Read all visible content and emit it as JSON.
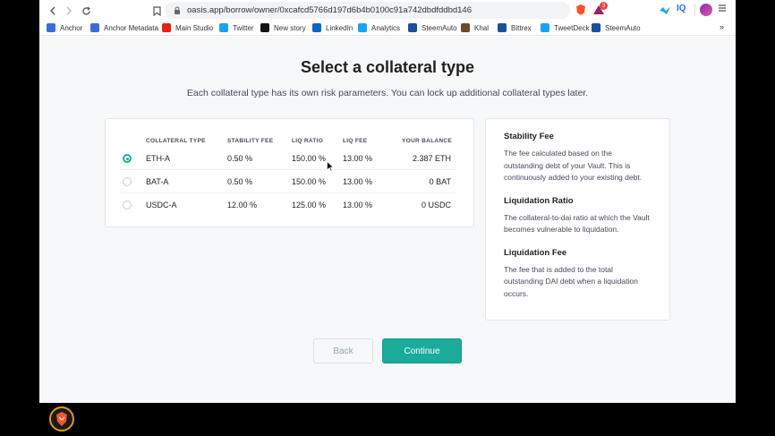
{
  "browser": {
    "url": "oasis.app/borrow/owner/0xcafcd5766d197d6b4b0100c91a742dbdfddbd146",
    "ext_badge": "3",
    "ext_iq": "IQ"
  },
  "bookmarks": [
    {
      "label": "Anchor",
      "color": "#3a6fd8"
    },
    {
      "label": "Anchor Metadata",
      "color": "#3a6fd8"
    },
    {
      "label": "Main Studio",
      "color": "#e62117"
    },
    {
      "label": "Twitter",
      "color": "#1da1f2"
    },
    {
      "label": "New story",
      "color": "#111111"
    },
    {
      "label": "LinkedIn",
      "color": "#0a66c2"
    },
    {
      "label": "Analytics",
      "color": "#1da1f2"
    },
    {
      "label": "SteemAuto",
      "color": "#1a5099"
    },
    {
      "label": "Khal",
      "color": "#6b4a2e"
    },
    {
      "label": "Bittrex",
      "color": "#1a5099"
    },
    {
      "label": "TweetDeck",
      "color": "#1da1f2"
    },
    {
      "label": "SteemAuto",
      "color": "#1a5099"
    }
  ],
  "bookmarks_more": "»",
  "page": {
    "title": "Select a collateral type",
    "subtitle": "Each collateral type has its own risk parameters. You can lock up additional collateral types later."
  },
  "table": {
    "headers": [
      "COLLATERAL TYPE",
      "STABILITY FEE",
      "LIQ RATIO",
      "LIQ FEE",
      "YOUR BALANCE"
    ],
    "rows": [
      {
        "type": "ETH-A",
        "stability_fee": "0.50 %",
        "liq_ratio": "150.00 %",
        "liq_fee": "13.00 %",
        "balance": "2.387 ETH",
        "selected": true
      },
      {
        "type": "BAT-A",
        "stability_fee": "0.50 %",
        "liq_ratio": "150.00 %",
        "liq_fee": "13.00 %",
        "balance": "0 BAT",
        "selected": false
      },
      {
        "type": "USDC-A",
        "stability_fee": "12.00 %",
        "liq_ratio": "125.00 %",
        "liq_fee": "13.00 %",
        "balance": "0 USDC",
        "selected": false
      }
    ]
  },
  "info": {
    "stability_fee_title": "Stability Fee",
    "stability_fee_text": "The fee calculated based on the outstanding debt of your Vault. This is continuously added to your existing debt.",
    "liq_ratio_title": "Liquidation Ratio",
    "liq_ratio_text": "The collateral-to-dai ratio at which the Vault becomes vulnerable to liquidation.",
    "liq_fee_title": "Liquidation Fee",
    "liq_fee_text": "The fee that is added to the total outstanding DAI debt when a liquidation occurs."
  },
  "buttons": {
    "back": "Back",
    "continue": "Continue"
  },
  "colors": {
    "accent": "#1aab9b"
  }
}
